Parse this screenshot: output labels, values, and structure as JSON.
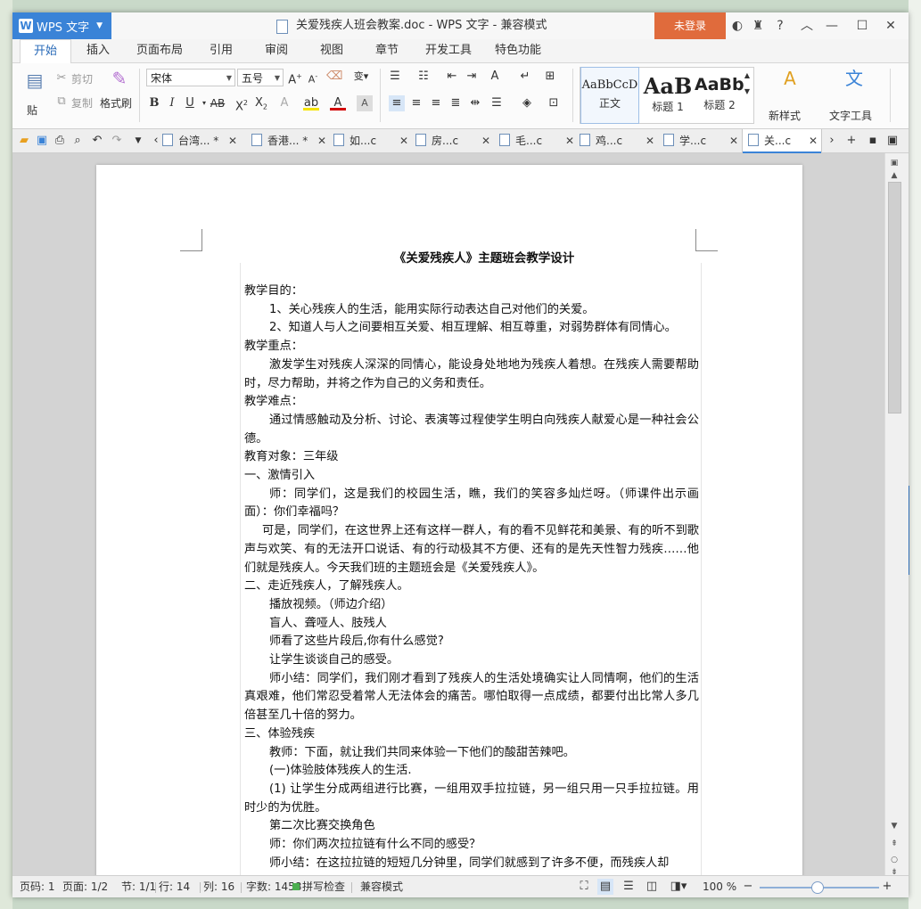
{
  "titlebar": {
    "app_name": "WPS 文字",
    "document_title": "关爱残疾人班会教案.doc - WPS 文字 - 兼容模式",
    "login_label": "未登录"
  },
  "ribbon_tabs": [
    "开始",
    "插入",
    "页面布局",
    "引用",
    "审阅",
    "视图",
    "章节",
    "开发工具",
    "特色功能"
  ],
  "ribbon": {
    "paste_label": "贴",
    "cut_label": "剪切",
    "copy_label": "复制",
    "format_painter_label": "格式刷",
    "font_name": "宋体",
    "font_size": "五号",
    "styles": [
      {
        "preview": "AaBbCcD",
        "label": "正文"
      },
      {
        "preview": "AaB",
        "label": "标题 1"
      },
      {
        "preview": "AaBb(",
        "label": "标题 2"
      }
    ],
    "new_style_label": "新样式",
    "text_tools_label": "文字工具"
  },
  "doc_tabs": [
    "台湾... *",
    "香港... *",
    "如...c",
    "房...c",
    "毛...c",
    "鸡...c",
    "学...c",
    "关...c"
  ],
  "document": {
    "title": "《关爱残疾人》主题班会教学设计",
    "paragraphs": [
      {
        "style": "",
        "text": "教学目的："
      },
      {
        "style": "i",
        "text": "1、关心残疾人的生活，能用实际行动表达自己对他们的关爱。"
      },
      {
        "style": "i",
        "text": "2、知道人与人之间要相互关爱、相互理解、相互尊重，对弱势群体有同情心。"
      },
      {
        "style": "",
        "text": "教学重点："
      },
      {
        "style": "i",
        "text": "激发学生对残疾人深深的同情心，能设身处地地为残疾人着想。在残疾人需要帮助时，尽力帮助，并将之作为自己的义务和责任。"
      },
      {
        "style": "",
        "text": "教学难点："
      },
      {
        "style": "i",
        "text": "通过情感触动及分析、讨论、表演等过程使学生明白向残疾人献爱心是一种社会公德。"
      },
      {
        "style": "",
        "text": "教育对象：三年级"
      },
      {
        "style": "",
        "text": "一、激情引入"
      },
      {
        "style": "i",
        "text": "师：同学们，这是我们的校园生活，瞧，我们的笑容多灿烂呀。（师课件出示画面）：你们幸福吗？"
      },
      {
        "style": "i2",
        "text": "可是，同学们，在这世界上还有这样一群人，有的看不见鲜花和美景、有的听不到歌声与欢笑、有的无法开口说话、有的行动极其不方便、还有的是先天性智力残疾……他们就是残疾人。今天我们班的主题班会是《关爱残疾人》。"
      },
      {
        "style": "",
        "text": "二、走近残疾人，了解残疾人。"
      },
      {
        "style": "i",
        "text": "播放视频。（师边介绍）"
      },
      {
        "style": "i",
        "text": "盲人、聋哑人、肢残人"
      },
      {
        "style": "i",
        "text": "师看了这些片段后,你有什么感觉?"
      },
      {
        "style": "i",
        "text": "让学生谈谈自己的感受。"
      },
      {
        "style": "i",
        "text": "师小结：同学们，我们刚才看到了残疾人的生活处境确实让人同情啊，他们的生活真艰难，他们常忍受着常人无法体会的痛苦。哪怕取得一点成绩，都要付出比常人多几倍甚至几十倍的努力。"
      },
      {
        "style": "",
        "text": "三、体验残疾"
      },
      {
        "style": "i",
        "text": "教师：下面，就让我们共同来体验一下他们的酸甜苦辣吧。"
      },
      {
        "style": "i",
        "text": "(一)体验肢体残疾人的生活."
      },
      {
        "style": "i",
        "text": "(1) 让学生分成两组进行比赛，一组用双手拉拉链，另一组只用一只手拉拉链。用时少的为优胜。"
      },
      {
        "style": "i",
        "text": "第二次比赛交换角色"
      },
      {
        "style": "i",
        "text": "师：你们两次拉拉链有什么不同的感受？"
      },
      {
        "style": "i",
        "text": "师小结：在这拉拉链的短短几分钟里，同学们就感到了许多不便，而残疾人却"
      }
    ]
  },
  "statusbar": {
    "page_num": "页码: 1",
    "page_of": "页面: 1/2",
    "section": "节: 1/1",
    "row": "行: 14",
    "col": "列: 16",
    "word_count": "字数: 1458",
    "spell_check": "拼写检查",
    "compat_mode": "兼容模式",
    "zoom": "100 %"
  },
  "colors": {
    "accent": "#3a83d7",
    "login": "#e06b3c",
    "spell_check_green": "#4caf50"
  }
}
